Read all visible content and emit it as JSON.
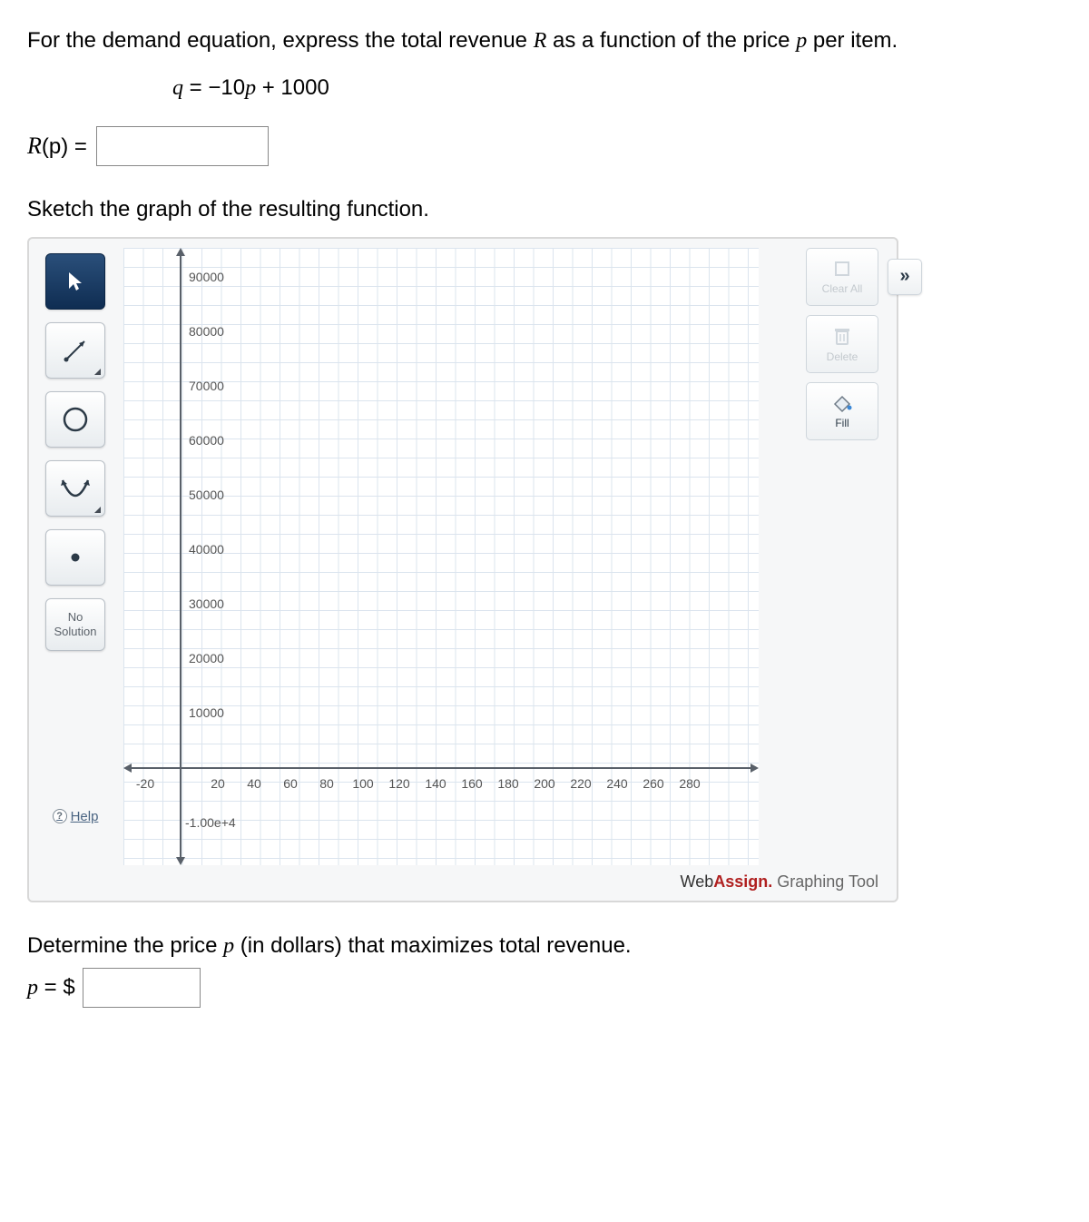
{
  "question": {
    "prompt_part1": "For the demand equation, express the total revenue ",
    "prompt_var_R": "R",
    "prompt_part2": " as a function of the price ",
    "prompt_var_p": "p",
    "prompt_part3": " per item.",
    "equation": "q = −10p + 1000",
    "rp_label_pre": "R",
    "rp_label_paren": "(p)",
    "rp_label_eq": " = ",
    "sketch_prompt": "Sketch the graph of the resulting function.",
    "determine_prompt_part1": "Determine the price ",
    "determine_var_p": "p",
    "determine_prompt_part2": " (in dollars) that maximizes total revenue.",
    "p_label": "p = $"
  },
  "tool_labels": {
    "no_solution_line1": "No",
    "no_solution_line2": "Solution",
    "help": "Help",
    "clear_all": "Clear All",
    "delete": "Delete",
    "fill": "Fill",
    "expand": "»"
  },
  "brand": {
    "web": "Web",
    "assign": "Assign.",
    "suffix": " Graphing Tool"
  },
  "chart_data": {
    "type": "scatter",
    "series": [],
    "xlabel": "",
    "ylabel": "",
    "xlim": [
      -30,
      290
    ],
    "ylim": [
      -10000,
      95000
    ],
    "x_ticks": [
      -20,
      20,
      40,
      60,
      80,
      100,
      120,
      140,
      160,
      180,
      200,
      220,
      240,
      260,
      280
    ],
    "y_ticks": [
      90000,
      80000,
      70000,
      60000,
      50000,
      40000,
      30000,
      20000,
      10000,
      "-1.00e+4"
    ],
    "grid": true
  }
}
